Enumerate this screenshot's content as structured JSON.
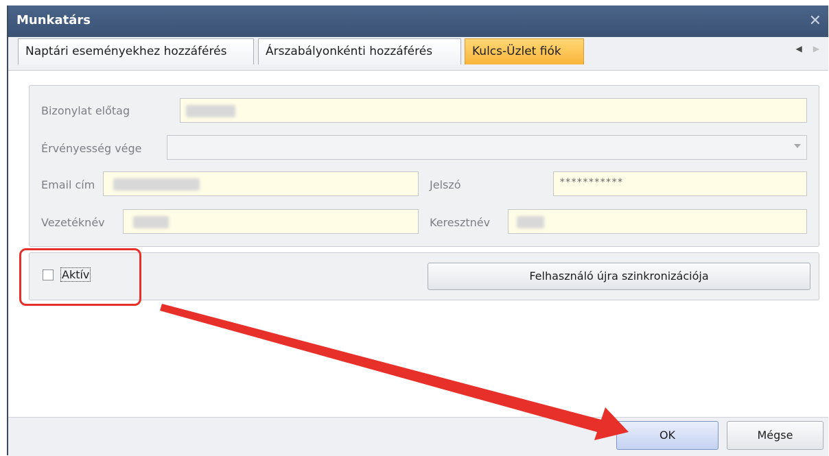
{
  "window": {
    "title": "Munkatárs"
  },
  "tabs": [
    {
      "label": "Naptári eseményekhez hozzáférés",
      "active": false
    },
    {
      "label": "Árszabályonkénti hozzáférés",
      "active": false
    },
    {
      "label": "Kulcs-Üzlet fiók",
      "active": true
    }
  ],
  "form": {
    "prefix_label": "Bizonylat előtag",
    "validity_label": "Érvényesség vége",
    "email_label": "Email cím",
    "password_label": "Jelszó",
    "password_value": "***********",
    "lastname_label": "Vezetéknév",
    "firstname_label": "Keresztnév"
  },
  "options": {
    "active_label": "Aktív",
    "active_checked": false,
    "resync_label": "Felhasználó újra szinkronizációja"
  },
  "buttons": {
    "ok": "OK",
    "cancel": "Mégse"
  },
  "colors": {
    "accent_tab": "#f9b53b",
    "title_bar": "#3a5274",
    "annotation": "#e8302a"
  }
}
